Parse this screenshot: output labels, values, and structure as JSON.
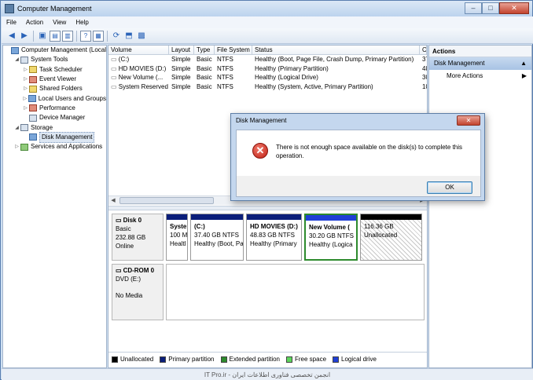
{
  "window": {
    "title": "Computer Management",
    "min": "–",
    "max": "□",
    "close": "✕"
  },
  "menu": [
    "File",
    "Action",
    "View",
    "Help"
  ],
  "tree": [
    {
      "label": "Computer Management (Local",
      "level": 0,
      "exp": "",
      "icon": "computer-icon"
    },
    {
      "label": "System Tools",
      "level": 1,
      "exp": "◢",
      "icon": "tools-icon"
    },
    {
      "label": "Task Scheduler",
      "level": 2,
      "exp": "▷",
      "icon": "clock-icon"
    },
    {
      "label": "Event Viewer",
      "level": 2,
      "exp": "▷",
      "icon": "event-icon"
    },
    {
      "label": "Shared Folders",
      "level": 2,
      "exp": "▷",
      "icon": "folder-icon"
    },
    {
      "label": "Local Users and Groups",
      "level": 2,
      "exp": "▷",
      "icon": "users-icon"
    },
    {
      "label": "Performance",
      "level": 2,
      "exp": "▷",
      "icon": "performance-icon"
    },
    {
      "label": "Device Manager",
      "level": 2,
      "exp": "",
      "icon": "device-icon"
    },
    {
      "label": "Storage",
      "level": 1,
      "exp": "◢",
      "icon": "storage-icon"
    },
    {
      "label": "Disk Management",
      "level": 2,
      "exp": "",
      "icon": "disk-icon",
      "selected": true
    },
    {
      "label": "Services and Applications",
      "level": 1,
      "exp": "▷",
      "icon": "services-icon"
    }
  ],
  "volumes": {
    "headers": [
      "Volume",
      "Layout",
      "Type",
      "File System",
      "Status",
      "C"
    ],
    "rows": [
      [
        "(C:)",
        "Simple",
        "Basic",
        "NTFS",
        "Healthy (Boot, Page File, Crash Dump, Primary Partition)",
        "37"
      ],
      [
        "HD MOVIES (D:)",
        "Simple",
        "Basic",
        "NTFS",
        "Healthy (Primary Partition)",
        "48"
      ],
      [
        "New Volume (...",
        "Simple",
        "Basic",
        "NTFS",
        "Healthy (Logical Drive)",
        "30"
      ],
      [
        "System Reserved",
        "Simple",
        "Basic",
        "NTFS",
        "Healthy (System, Active, Primary Partition)",
        "10"
      ]
    ]
  },
  "disks": [
    {
      "name": "Disk 0",
      "type": "Basic",
      "size": "232.88 GB",
      "state": "Online",
      "partitions": [
        {
          "name": "Syste",
          "size": "100 M",
          "status": "Healtl"
        },
        {
          "name": "(C:)",
          "size": "37.40 GB NTFS",
          "status": "Healthy (Boot, Pa"
        },
        {
          "name": "HD MOVIES  (D:)",
          "size": "48.83 GB NTFS",
          "status": "Healthy (Primary"
        },
        {
          "name": "New Volume  (",
          "size": "30.20 GB NTFS",
          "status": "Healthy (Logica"
        },
        {
          "name": "",
          "size": "116.36 GB",
          "status": "Unallocated"
        }
      ]
    },
    {
      "name": "CD-ROM 0",
      "type": "DVD (E:)",
      "size": "",
      "state": "No Media",
      "partitions": []
    }
  ],
  "legend": [
    {
      "label": "Unallocated",
      "color": "#000000"
    },
    {
      "label": "Primary partition",
      "color": "#0b1e7a"
    },
    {
      "label": "Extended partition",
      "color": "#2d8a2d"
    },
    {
      "label": "Free space",
      "color": "#5cd65c"
    },
    {
      "label": "Logical drive",
      "color": "#1f3fd6"
    }
  ],
  "actions": {
    "header": "Actions",
    "section": "Disk Management",
    "item": "More Actions",
    "section_arrow": "▲",
    "item_arrow": "▶"
  },
  "dialog": {
    "title": "Disk Management",
    "close": "✕",
    "message": "There is not enough space available on the disk(s) to complete this operation.",
    "ok": "OK"
  },
  "status": {
    "watermark": "IT Pro.ir - انجمن تخصصی فناوری اطلاعات ایران"
  }
}
